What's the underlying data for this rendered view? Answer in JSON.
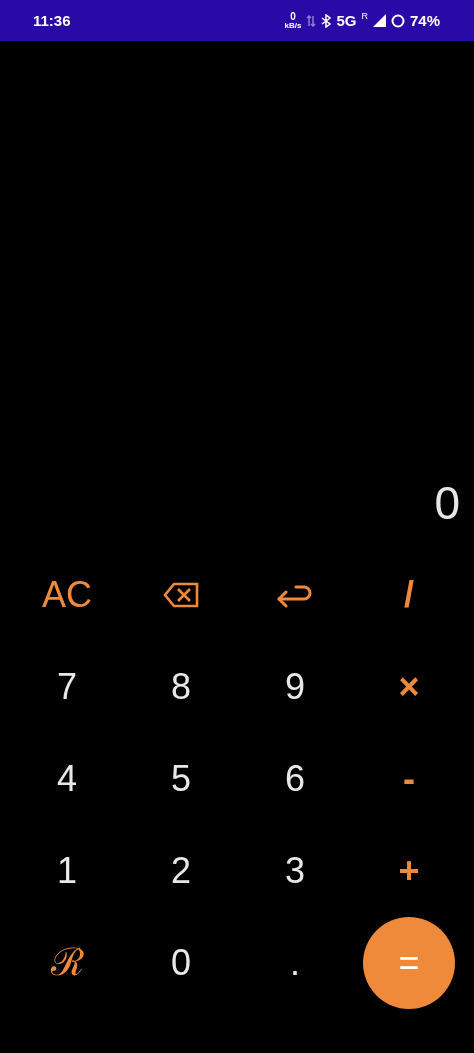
{
  "status_bar": {
    "time": "11:36",
    "speed_value": "0",
    "speed_unit": "kB/s",
    "network": "5G",
    "roaming": "R",
    "battery": "74%"
  },
  "display": {
    "value": "0"
  },
  "keys": [
    {
      "kind": "operator",
      "label": "AC"
    },
    {
      "kind": "backspace"
    },
    {
      "kind": "undo"
    },
    {
      "kind": "operator",
      "label": "/"
    },
    {
      "kind": "digit",
      "label": "7"
    },
    {
      "kind": "digit",
      "label": "8"
    },
    {
      "kind": "digit",
      "label": "9"
    },
    {
      "kind": "operator",
      "label": "×"
    },
    {
      "kind": "digit",
      "label": "4"
    },
    {
      "kind": "digit",
      "label": "5"
    },
    {
      "kind": "digit",
      "label": "6"
    },
    {
      "kind": "operator",
      "label": "-"
    },
    {
      "kind": "digit",
      "label": "1"
    },
    {
      "kind": "digit",
      "label": "2"
    },
    {
      "kind": "digit",
      "label": "3"
    },
    {
      "kind": "operator",
      "label": "+"
    },
    {
      "kind": "script",
      "label": "ℛ"
    },
    {
      "kind": "digit",
      "label": "0"
    },
    {
      "kind": "digit",
      "label": "."
    },
    {
      "kind": "equals",
      "label": "="
    }
  ]
}
